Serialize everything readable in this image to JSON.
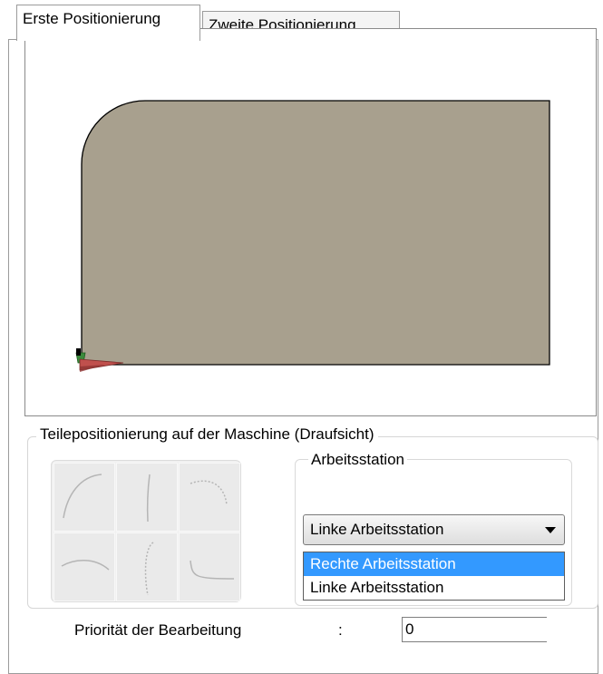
{
  "tabs": [
    {
      "label": "Erste Positionierung",
      "active": true
    },
    {
      "label": "Zweite Positionierung",
      "active": false
    }
  ],
  "viewport": {
    "part_color": "#a8a08e",
    "axis_colors": {
      "x": "#c0504d",
      "y": "#3c8a3c"
    }
  },
  "positioning": {
    "title": "Teilepositionierung auf der Maschine (Draufsicht)",
    "cells": [
      "curve-top-left-icon",
      "curve-top-center-icon",
      "curve-top-right-icon",
      "curve-bottom-left-icon",
      "curve-bottom-center-icon",
      "curve-bottom-right-icon"
    ]
  },
  "workstation": {
    "title": "Arbeitsstation",
    "selected": "Linke Arbeitsstation",
    "options": [
      "Rechte Arbeitsstation",
      "Linke Arbeitsstation"
    ],
    "highlight_color": "#3399ff"
  },
  "priority": {
    "label": "Priorität der Bearbeitung",
    "separator": ":",
    "value": "0"
  }
}
